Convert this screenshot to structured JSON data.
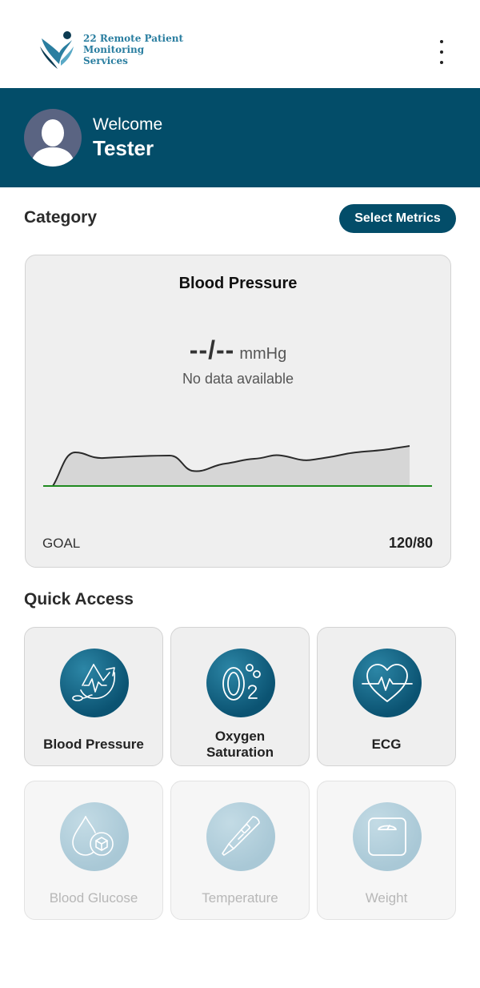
{
  "header": {
    "logo_line1": "22 Remote Patient",
    "logo_line2": "Monitoring Services",
    "menu_icon": "kebab-menu-icon"
  },
  "user": {
    "greeting": "Welcome",
    "name": "Tester",
    "avatar_icon": "user-silhouette-icon"
  },
  "category": {
    "title": "Category",
    "select_button": "Select Metrics"
  },
  "metric_card": {
    "title": "Blood Pressure",
    "value": "--/--",
    "unit": "mmHg",
    "status": "No data available",
    "goal_label": "GOAL",
    "goal_value": "120/80"
  },
  "quick_access": {
    "title": "Quick Access",
    "items": [
      {
        "label": "Blood Pressure",
        "icon": "blood-pressure-icon",
        "enabled": true
      },
      {
        "label": "Oxygen",
        "label2": "Saturation",
        "icon": "oxygen-saturation-icon",
        "enabled": true
      },
      {
        "label": "ECG",
        "icon": "ecg-heart-icon",
        "enabled": true
      },
      {
        "label": "Blood Glucose",
        "icon": "blood-glucose-icon",
        "enabled": false
      },
      {
        "label": "Temperature",
        "icon": "thermometer-icon",
        "enabled": false
      },
      {
        "label": "Weight",
        "icon": "scale-icon",
        "enabled": false
      }
    ]
  },
  "colors": {
    "primary": "#034d69",
    "goal_line": "#1f8a1f",
    "card_bg": "#efefef"
  }
}
